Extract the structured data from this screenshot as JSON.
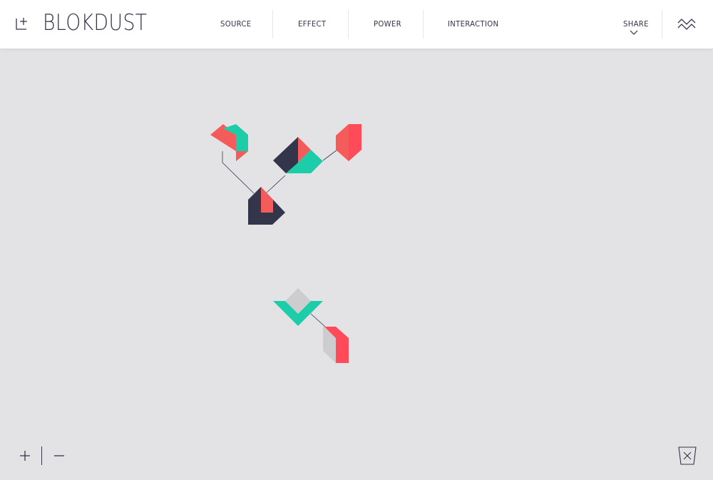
{
  "app": {
    "title": "BLOKDUST"
  },
  "header": {
    "nav": [
      "SOURCE",
      "EFFECT",
      "POWER",
      "INTERACTION"
    ],
    "share_label": "SHARE"
  },
  "icons": {
    "new": "new-document-icon",
    "menu": "zigzag-menu-icon",
    "share": "chevron-down-icon",
    "zoom_in": "plus-icon",
    "zoom_out": "minus-icon",
    "trash": "trash-icon"
  },
  "colors": {
    "background": "#e3e3e6",
    "header": "#ffffff",
    "navy": "#33354a",
    "coral": "#f45c5b",
    "red": "#ff4a59",
    "teal": "#1dcda9",
    "grey": "#cdcdd0",
    "wire": "#33354a"
  }
}
